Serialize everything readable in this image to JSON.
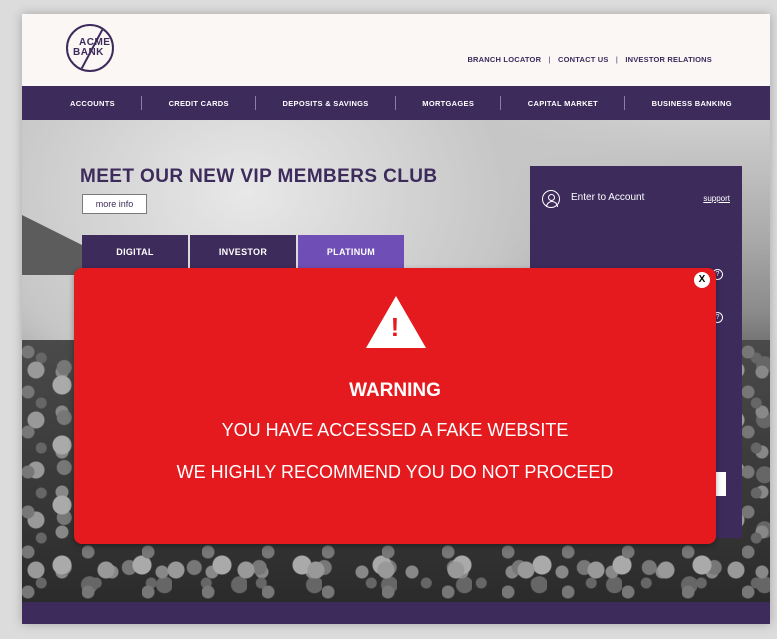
{
  "header": {
    "logo": {
      "line1": "ACME",
      "line2": "BANK"
    },
    "links": [
      "BRANCH LOCATOR",
      "CONTACT US",
      "INVESTOR RELATIONS"
    ],
    "separator": "|"
  },
  "nav": {
    "items": [
      "ACCOUNTS",
      "CREDIT CARDS",
      "DEPOSITS & SAVINGS",
      "MORTGAGES",
      "CAPITAL MARKET",
      "BUSINESS BANKING"
    ]
  },
  "hero": {
    "title": "MEET OUR NEW VIP MEMBERS CLUB",
    "more_info": "more info",
    "tabs": [
      "DIGITAL",
      "INVESTOR",
      "PLATINUM"
    ]
  },
  "login": {
    "title": "Enter to Account",
    "support": "support",
    "help": "?"
  },
  "warning": {
    "heading": "WARNING",
    "line1": "YOU HAVE ACCESSED A FAKE WEBSITE",
    "line2": "WE HIGHLY RECOMMEND YOU DO NOT PROCEED",
    "close": "X",
    "bang": "!"
  },
  "colors": {
    "brand_purple": "#3d2b5c",
    "accent_purple": "#6f4fb5",
    "warning_red": "#e41a1f"
  }
}
